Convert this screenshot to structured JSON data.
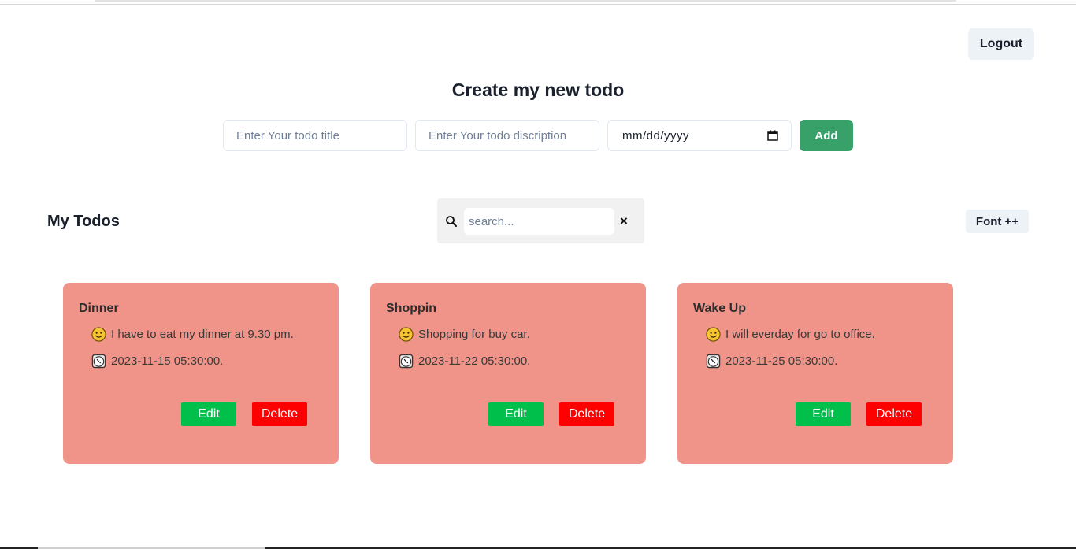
{
  "header": {
    "logout_label": "Logout"
  },
  "create": {
    "heading": "Create my new todo",
    "title_placeholder": "Enter Your todo title",
    "desc_placeholder": "Enter Your todo discription",
    "date_placeholder": "mm/dd/yyyy",
    "add_label": "Add"
  },
  "list": {
    "heading": "My Todos",
    "search_placeholder": "search...",
    "clear_symbol": "×",
    "font_label": "Font ++"
  },
  "todos": [
    {
      "title": "Dinner",
      "description": "I have to eat my dinner at 9.30 pm.",
      "date": "2023-11-15 05:30:00.",
      "edit_label": "Edit",
      "delete_label": "Delete"
    },
    {
      "title": "Shoppin",
      "description": "Shopping for buy car.",
      "date": "2023-11-22 05:30:00.",
      "edit_label": "Edit",
      "delete_label": "Delete"
    },
    {
      "title": "Wake Up",
      "description": "I will everday for go to office.",
      "date": "2023-11-25 05:30:00.",
      "edit_label": "Edit",
      "delete_label": "Delete"
    }
  ],
  "icons": {
    "description": "smiley-icon",
    "date": "clock-icon",
    "search": "search-icon",
    "calendar": "calendar-icon"
  },
  "colors": {
    "card_bg": "#f09389",
    "add_button": "#38a169",
    "edit_button": "#00c04b",
    "delete_button": "#ff0000"
  }
}
